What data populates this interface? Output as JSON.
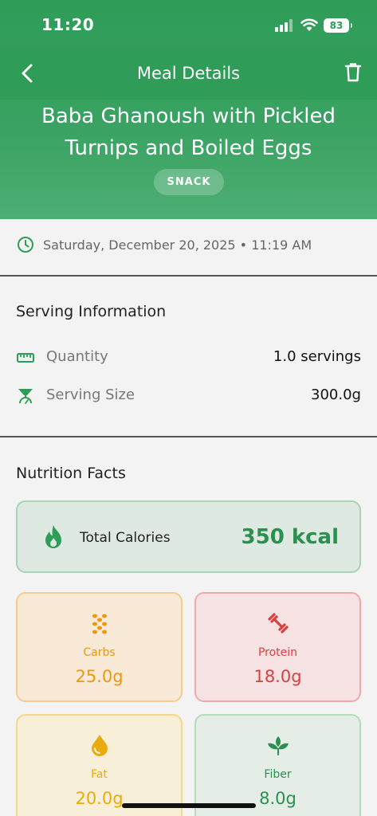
{
  "status_bar": {
    "time": "11:20",
    "battery": "83"
  },
  "nav": {
    "title": "Meal Details",
    "back_icon": "chevron-left-icon",
    "delete_icon": "trash-icon"
  },
  "meal": {
    "title": "Baba Ghanoush with Pickled Turnips and Boiled Eggs",
    "category": "SNACK",
    "datetime": "Saturday, December 20, 2025 • 11:19 AM"
  },
  "serving": {
    "section_title": "Serving Information",
    "quantity_label": "Quantity",
    "quantity_value": "1.0 servings",
    "size_label": "Serving Size",
    "size_value": "300.0g"
  },
  "nutrition": {
    "section_title": "Nutrition Facts",
    "calories_label": "Total Calories",
    "calories_value": "350 kcal",
    "macros": [
      {
        "label": "Carbs",
        "value": "25.0g",
        "icon": "grains-icon",
        "color": "#f0960f"
      },
      {
        "label": "Protein",
        "value": "18.0g",
        "icon": "dumbbell-icon",
        "color": "#d94040"
      },
      {
        "label": "Fat",
        "value": "20.0g",
        "icon": "drop-icon",
        "color": "#e9ab10"
      },
      {
        "label": "Fiber",
        "value": "8.0g",
        "icon": "leaf-icon",
        "color": "#2c8f50"
      }
    ]
  },
  "colors": {
    "primary": "#2f9c58",
    "calories_text": "#2c8f50"
  }
}
